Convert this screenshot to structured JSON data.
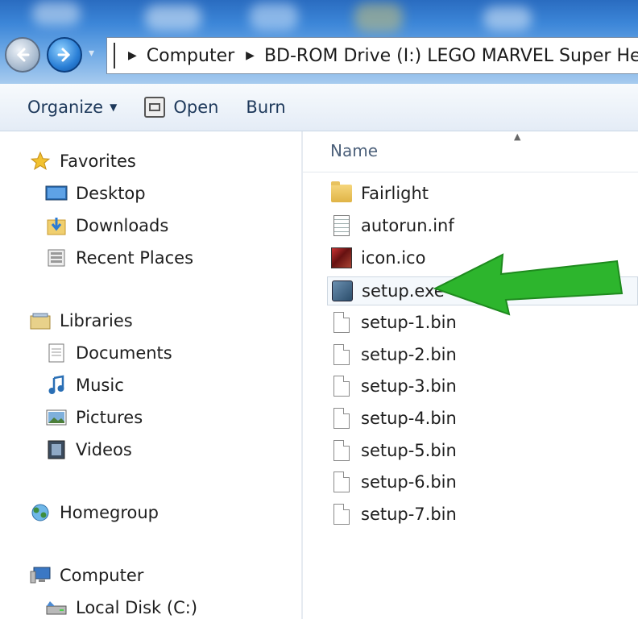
{
  "address_bar": {
    "crumbs": [
      "Computer",
      "BD-ROM Drive (I:) LEGO MARVEL Super Hero"
    ]
  },
  "toolbar": {
    "organize": "Organize",
    "open": "Open",
    "burn": "Burn"
  },
  "nav": {
    "favorites": "Favorites",
    "desktop": "Desktop",
    "downloads": "Downloads",
    "recent_places": "Recent Places",
    "libraries": "Libraries",
    "documents": "Documents",
    "music": "Music",
    "pictures": "Pictures",
    "videos": "Videos",
    "homegroup": "Homegroup",
    "computer": "Computer",
    "local_disk": "Local Disk (C:)"
  },
  "files": {
    "column_name": "Name",
    "items": [
      {
        "name": "Fairlight",
        "icon": "folder-icon"
      },
      {
        "name": "autorun.inf",
        "icon": "settings-file-icon"
      },
      {
        "name": "icon.ico",
        "icon": "image-file-icon"
      },
      {
        "name": "setup.exe",
        "icon": "installer-icon"
      },
      {
        "name": "setup-1.bin",
        "icon": "file-icon"
      },
      {
        "name": "setup-2.bin",
        "icon": "file-icon"
      },
      {
        "name": "setup-3.bin",
        "icon": "file-icon"
      },
      {
        "name": "setup-4.bin",
        "icon": "file-icon"
      },
      {
        "name": "setup-5.bin",
        "icon": "file-icon"
      },
      {
        "name": "setup-6.bin",
        "icon": "file-icon"
      },
      {
        "name": "setup-7.bin",
        "icon": "file-icon"
      }
    ]
  },
  "colors": {
    "accent_arrow": "#2db52d",
    "toolbar_text": "#1e395b"
  }
}
